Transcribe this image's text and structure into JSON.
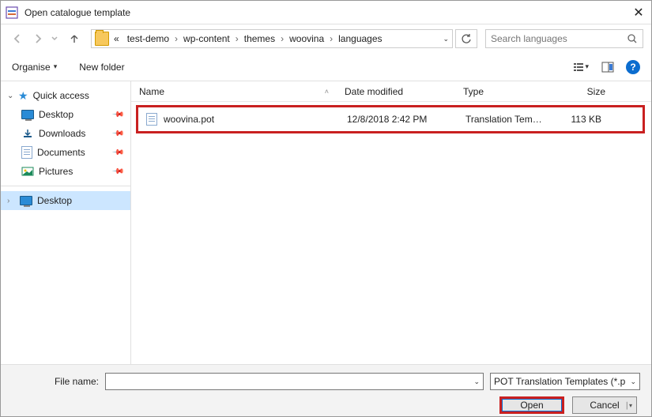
{
  "window": {
    "title": "Open catalogue template"
  },
  "nav": {
    "breadcrumb_prefix": "«",
    "crumbs": [
      "test-demo",
      "wp-content",
      "themes",
      "woovina",
      "languages"
    ],
    "search_placeholder": "Search languages"
  },
  "toolbar": {
    "organise": "Organise",
    "newfolder": "New folder",
    "help": "?"
  },
  "sidebar": {
    "quick_access": "Quick access",
    "desktop": "Desktop",
    "downloads": "Downloads",
    "documents": "Documents",
    "pictures": "Pictures",
    "root_desktop": "Desktop"
  },
  "columns": {
    "name": "Name",
    "date": "Date modified",
    "type": "Type",
    "size": "Size"
  },
  "files": [
    {
      "name": "woovina.pot",
      "date": "12/8/2018 2:42 PM",
      "type": "Translation Templ...",
      "size": "113 KB"
    }
  ],
  "footer": {
    "filename_label": "File name:",
    "filter": "POT Translation Templates (*.p",
    "open": "Open",
    "cancel": "Cancel"
  }
}
